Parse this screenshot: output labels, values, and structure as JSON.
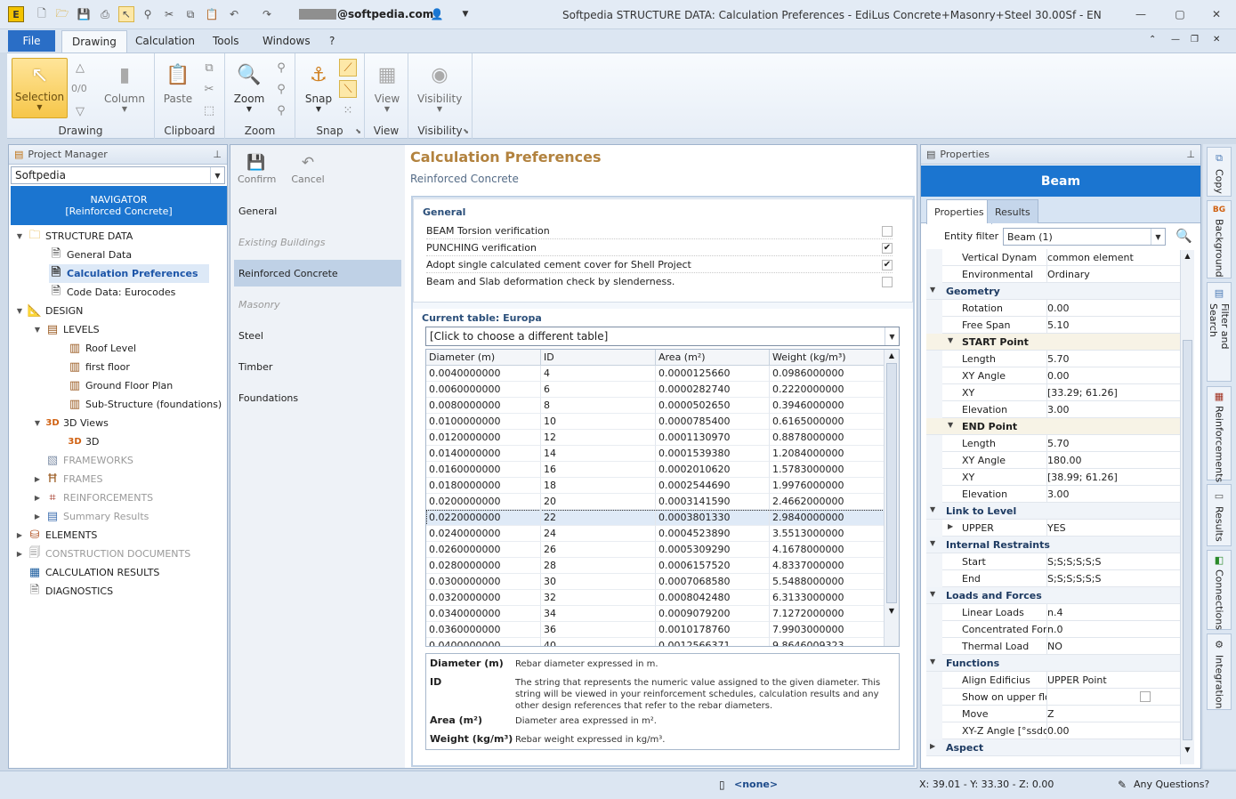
{
  "app": {
    "window_title": "Softpedia  STRUCTURE DATA: Calculation Preferences - EdiLus Concrete+Masonry+Steel 30.00Sf - EN",
    "user": "@softpedia.com",
    "controls": {
      "minimize": "—",
      "restore": "▢",
      "close": "✕"
    }
  },
  "ribbon_tabs": {
    "file": "File",
    "drawing": "Drawing",
    "calculation": "Calculation",
    "tools": "Tools",
    "windows": "Windows",
    "help": "?"
  },
  "ribbon": {
    "drawing_group": {
      "selection": "Selection",
      "counter": "0/0",
      "column": "Column",
      "label": "Drawing"
    },
    "clipboard_group": {
      "paste": "Paste",
      "label": "Clipboard"
    },
    "zoom_group": {
      "zoom": "Zoom",
      "label": "Zoom"
    },
    "snap_group": {
      "snap": "Snap",
      "label": "Snap"
    },
    "view_group": {
      "view": "View",
      "label": "View"
    },
    "visibility_group": {
      "visibility": "Visibility",
      "label": "Visibility"
    }
  },
  "project_manager": {
    "title": "Project Manager",
    "project": "Softpedia",
    "navigator_line1": "NAVIGATOR",
    "navigator_line2": "[Reinforced Concrete]",
    "tree": [
      {
        "label": "STRUCTURE DATA",
        "icon": "folder-icon"
      },
      {
        "label": "General Data",
        "icon": "document-icon"
      },
      {
        "label": "Calculation Preferences",
        "icon": "document-icon"
      },
      {
        "label": "Code Data: Eurocodes",
        "icon": "document-icon"
      },
      {
        "label": "DESIGN",
        "icon": "design-icon"
      },
      {
        "label": "LEVELS",
        "icon": "levels-icon"
      },
      {
        "label": "Roof Level",
        "icon": "level-icon"
      },
      {
        "label": "first floor",
        "icon": "level-icon"
      },
      {
        "label": "Ground Floor Plan",
        "icon": "level-icon"
      },
      {
        "label": "Sub-Structure (foundations)",
        "icon": "level-icon"
      },
      {
        "label": "3D Views",
        "icon": "3d-icon"
      },
      {
        "label": "3D",
        "icon": "3d-icon"
      },
      {
        "label": "FRAMEWORKS",
        "icon": "frameworks-icon"
      },
      {
        "label": "FRAMES",
        "icon": "frames-icon"
      },
      {
        "label": "REINFORCEMENTS",
        "icon": "reinforcements-icon"
      },
      {
        "label": "Summary Results",
        "icon": "results-icon"
      },
      {
        "label": "ELEMENTS",
        "icon": "elements-icon"
      },
      {
        "label": "CONSTRUCTION DOCUMENTS",
        "icon": "documents-icon"
      },
      {
        "label": "CALCULATION RESULTS",
        "icon": "calculation-icon"
      },
      {
        "label": "DIAGNOSTICS",
        "icon": "diagnostics-icon"
      }
    ]
  },
  "center": {
    "confirm": "Confirm",
    "cancel": "Cancel",
    "nav": [
      "General",
      "Existing Buildings",
      "Reinforced Concrete",
      "Masonry",
      "Steel",
      "Timber",
      "Foundations"
    ],
    "title": "Calculation Preferences",
    "subtitle": "Reinforced Concrete",
    "general": {
      "title": "General",
      "options": [
        {
          "label": "BEAM Torsion verification",
          "checked": ""
        },
        {
          "label": "PUNCHING verification",
          "checked": "✔"
        },
        {
          "label": "Adopt single calculated cement cover for Shell Project",
          "checked": "✔"
        },
        {
          "label": "Beam and Slab deformation check by slenderness.",
          "checked": ""
        }
      ]
    },
    "table": {
      "title": "Current table: Europa",
      "chooser": "[Click to choose a different table]",
      "headers": [
        "Diameter (m)",
        "ID",
        "Area (m²)",
        "Weight (kg/m³)"
      ],
      "rows": [
        [
          "0.0040000000",
          "4",
          "0.0000125660",
          "0.0986000000"
        ],
        [
          "0.0060000000",
          "6",
          "0.0000282740",
          "0.2220000000"
        ],
        [
          "0.0080000000",
          "8",
          "0.0000502650",
          "0.3946000000"
        ],
        [
          "0.0100000000",
          "10",
          "0.0000785400",
          "0.6165000000"
        ],
        [
          "0.0120000000",
          "12",
          "0.0001130970",
          "0.8878000000"
        ],
        [
          "0.0140000000",
          "14",
          "0.0001539380",
          "1.2084000000"
        ],
        [
          "0.0160000000",
          "16",
          "0.0002010620",
          "1.5783000000"
        ],
        [
          "0.0180000000",
          "18",
          "0.0002544690",
          "1.9976000000"
        ],
        [
          "0.0200000000",
          "20",
          "0.0003141590",
          "2.4662000000"
        ],
        [
          "0.0220000000",
          "22",
          "0.0003801330",
          "2.9840000000"
        ],
        [
          "0.0240000000",
          "24",
          "0.0004523890",
          "3.5513000000"
        ],
        [
          "0.0260000000",
          "26",
          "0.0005309290",
          "4.1678000000"
        ],
        [
          "0.0280000000",
          "28",
          "0.0006157520",
          "4.8337000000"
        ],
        [
          "0.0300000000",
          "30",
          "0.0007068580",
          "5.5488000000"
        ],
        [
          "0.0320000000",
          "32",
          "0.0008042480",
          "6.3133000000"
        ],
        [
          "0.0340000000",
          "34",
          "0.0009079200",
          "7.1272000000"
        ],
        [
          "0.0360000000",
          "36",
          "0.0010178760",
          "7.9903000000"
        ],
        [
          "0.0400000000",
          "40",
          "0.0012566371",
          "9.8646009323"
        ]
      ],
      "selected_row": 9
    },
    "descriptions": [
      {
        "key": "Diameter (m)",
        "text": "Rebar diameter expressed in m."
      },
      {
        "key": "ID",
        "text": "The string that represents the numeric value assigned to the given diameter. This string will be viewed in your reinforcement schedules, calculation results and any other design references that refer to the rebar diameters."
      },
      {
        "key": "Area (m²)",
        "text": "Diameter area expressed in m²."
      },
      {
        "key": "Weight (kg/m³)",
        "text": "Rebar weight expressed in kg/m³."
      }
    ]
  },
  "properties": {
    "title": "Properties",
    "object": "Beam",
    "tab_properties": "Properties",
    "tab_results": "Results",
    "entity_filter_label": "Entity filter",
    "entity_filter_value": "Beam (1)",
    "rows": [
      {
        "kind": "item",
        "key": "Vertical Dynam",
        "value": "common element"
      },
      {
        "kind": "item",
        "key": "Environmental",
        "value": "Ordinary"
      },
      {
        "kind": "cat",
        "key": "Geometry",
        "value": ""
      },
      {
        "kind": "item",
        "key": "Rotation",
        "value": "0.00"
      },
      {
        "kind": "item",
        "key": "Free Span",
        "value": "5.10"
      },
      {
        "kind": "sub",
        "key": "START Point",
        "value": ""
      },
      {
        "kind": "item",
        "key": "Length",
        "value": "5.70"
      },
      {
        "kind": "item",
        "key": "XY Angle",
        "value": "0.00"
      },
      {
        "kind": "item",
        "key": "XY",
        "value": "[33.29; 61.26]"
      },
      {
        "kind": "item",
        "key": "Elevation",
        "value": "3.00"
      },
      {
        "kind": "sub",
        "key": "END Point",
        "value": ""
      },
      {
        "kind": "item",
        "key": "Length",
        "value": "5.70"
      },
      {
        "kind": "item",
        "key": "XY Angle",
        "value": "180.00"
      },
      {
        "kind": "item",
        "key": "XY",
        "value": "[38.99; 61.26]"
      },
      {
        "kind": "item",
        "key": "Elevation",
        "value": "3.00"
      },
      {
        "kind": "cat",
        "key": "Link to Level",
        "value": ""
      },
      {
        "kind": "item",
        "key": "UPPER",
        "value": "YES"
      },
      {
        "kind": "cat",
        "key": "Internal Restraints",
        "value": ""
      },
      {
        "kind": "item",
        "key": "Start",
        "value": "S;S;S;S;S;S"
      },
      {
        "kind": "item",
        "key": "End",
        "value": "S;S;S;S;S;S"
      },
      {
        "kind": "cat",
        "key": "Loads and Forces",
        "value": ""
      },
      {
        "kind": "item",
        "key": "Linear Loads",
        "value": "n.4"
      },
      {
        "kind": "item",
        "key": "Concentrated Forc",
        "value": "n.0"
      },
      {
        "kind": "item",
        "key": "Thermal Load",
        "value": "NO"
      },
      {
        "kind": "cat",
        "key": "Functions",
        "value": ""
      },
      {
        "kind": "item",
        "key": "Align Edificius",
        "value": "UPPER Point"
      },
      {
        "kind": "item",
        "key": "Show on upper floo",
        "value": ""
      },
      {
        "kind": "item",
        "key": "Move",
        "value": "Z"
      },
      {
        "kind": "item",
        "key": "XY-Z Angle  [°ssdc]",
        "value": "0.00"
      },
      {
        "kind": "cat",
        "key": "Aspect",
        "value": ""
      }
    ]
  },
  "sidebar_tabs": [
    "Copy",
    "Background",
    "Filter and Search",
    "Reinforcements",
    "Results",
    "Connections",
    "Integration"
  ],
  "status": {
    "layer": "<none>",
    "coords": "X: 39.01 - Y: 33.30 - Z: 0.00",
    "help": "Any Questions?"
  },
  "colors": {
    "accent": "#1b75d0",
    "title_gold": "#b2823e",
    "file_tab": "#2a6ec6"
  }
}
